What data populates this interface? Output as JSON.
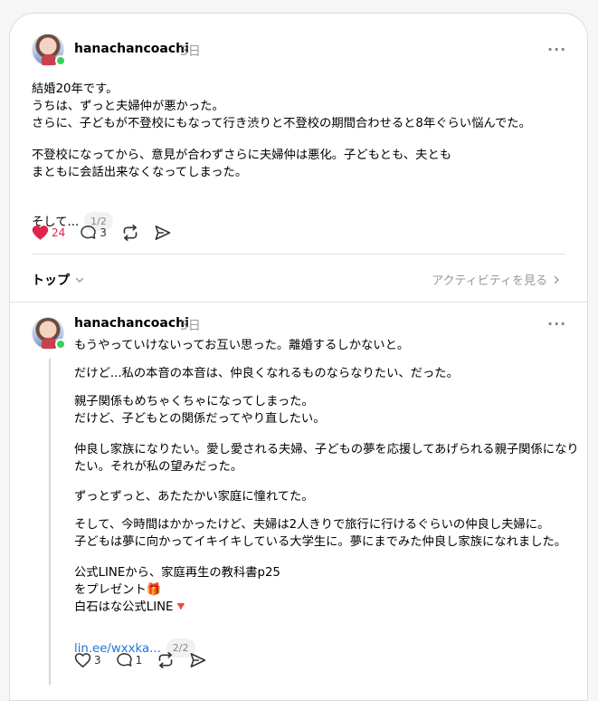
{
  "post1": {
    "username": "hanachancoachi",
    "time": "3日",
    "paragraphs": [
      "結婚20年です。\nうちは、ずっと夫婦仲が悪かった。\nさらに、子どもが不登校にもなって行き渋りと不登校の期間合わせると8年ぐらい悩んでた。",
      "不登校になってから、意見が合わずさらに夫婦仲は悪化。子どもとも、夫とも\nまともに会話出来なくなってしまった。",
      "そして..."
    ],
    "pager": "1/2",
    "likes": "24",
    "replies": "3"
  },
  "sort": {
    "label": "トップ",
    "activity_link": "アクティビティを見る"
  },
  "post2": {
    "username": "hanachancoachi",
    "time": "3日",
    "paragraphs": [
      "もうやっていけないってお互い思った。離婚するしかないと。",
      "だけど...私の本音の本音は、仲良くなれるものならなりたい、だった。",
      "親子関係もめちゃくちゃになってしまった。\nだけど、子どもとの関係だってやり直したい。",
      "仲良し家族になりたい。愛し愛される夫婦、子どもの夢を応援してあげられる親子関係になり\nたい。それが私の望みだった。",
      "ずっとずっと、あたたかい家庭に憧れてた。",
      "そして、今時間はかかったけど、夫婦は2人きりで旅行に行けるぐらいの仲良し夫婦に。\n子どもは夢に向かってイキイキしている大学生に。夢にまでみた仲良し家族になれました。",
      "公式LINEから、家庭再生の教科書p25\nをプレゼント🎁\n白石はな公式LINE🔻"
    ],
    "link_text": "lin.ee/wxxka...",
    "pager": "2/2",
    "likes": "3",
    "replies": "1"
  },
  "colors": {
    "like_red": "#e0244c",
    "online_green": "#38d05b",
    "link_blue": "#1d78d8"
  },
  "icons": [
    "heart-icon",
    "comment-icon",
    "repost-icon",
    "share-icon",
    "more-icon",
    "chevron-down-icon",
    "chevron-right-icon"
  ]
}
